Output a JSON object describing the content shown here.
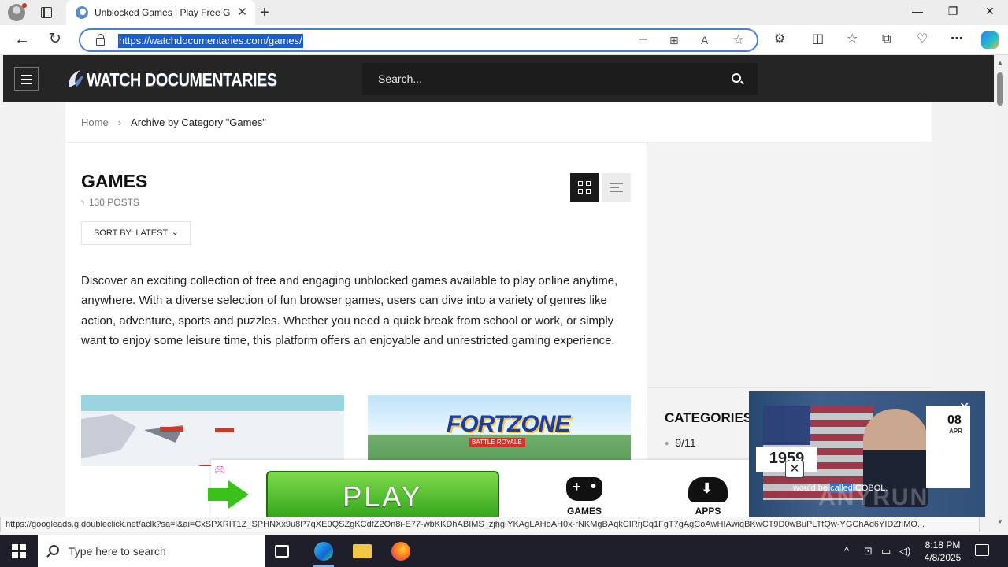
{
  "browser": {
    "tab_title": "Unblocked Games | Play Free Games",
    "tab_close": "✕",
    "new_tab": "+",
    "window_controls": {
      "minimize": "—",
      "maximize": "❐",
      "close": "✕"
    },
    "back": "←",
    "reload": "↻",
    "url": "https://watchdocumentaries.com/games/",
    "status_url": "https://googleads.g.doubleclick.net/aclk?sa=l&ai=CxSPXRIT1Z_SPHNXx9u8P7qXE0QSZgKCdfZ2On8i-E77-wbKKDhABIMS_zjhgIYKAgLAHoAH0x-rNKMgBAqkCIRrjCq1FgT7gAgCoAwHIAwiqBKwCT9D0wBuPLTfQw-YGChAd6YIDZfIMO...",
    "toolbar_icons": [
      "⚙",
      "◫",
      "☆",
      "⧉",
      "♡",
      "⋯"
    ]
  },
  "site": {
    "logo": "WATCH DOCUMENTARIES",
    "search_placeholder": "Search...",
    "breadcrumb": {
      "home": "Home",
      "separator": "›",
      "current": "Archive by Category \"Games\""
    },
    "title": "GAMES",
    "posts_count": "130 POSTS",
    "sort_label": "SORT BY: LATEST",
    "description": "Discover an exciting collection of free and engaging unblocked games available to play online anytime, anywhere. With a diverse selection of fun browser games, users can dive into a variety of genres like action, adventure, sports and puzzles. Whether you need a quick break from school or work, or simply want to enjoy some leisure time, this platform offers an enjoyable and unrestricted gaming experience.",
    "thumb2_title": "FORTZONE",
    "thumb2_subtitle": "BATTLE ROYALE",
    "sidebar": {
      "categories_heading": "CATEGORIES",
      "categories": [
        "9/11"
      ]
    }
  },
  "ads": {
    "play_label": "PLAY",
    "games_label": "GAMES",
    "apps_label": "APPS",
    "video": {
      "day": "08",
      "month": "APR",
      "year": "1959",
      "caption_pre": "would be ",
      "caption_hl": "called",
      "caption_post": " COBOL.",
      "close": "✕"
    }
  },
  "taskbar": {
    "search_placeholder": "Type here to search",
    "time": "8:18 PM",
    "date": "4/8/2025"
  }
}
